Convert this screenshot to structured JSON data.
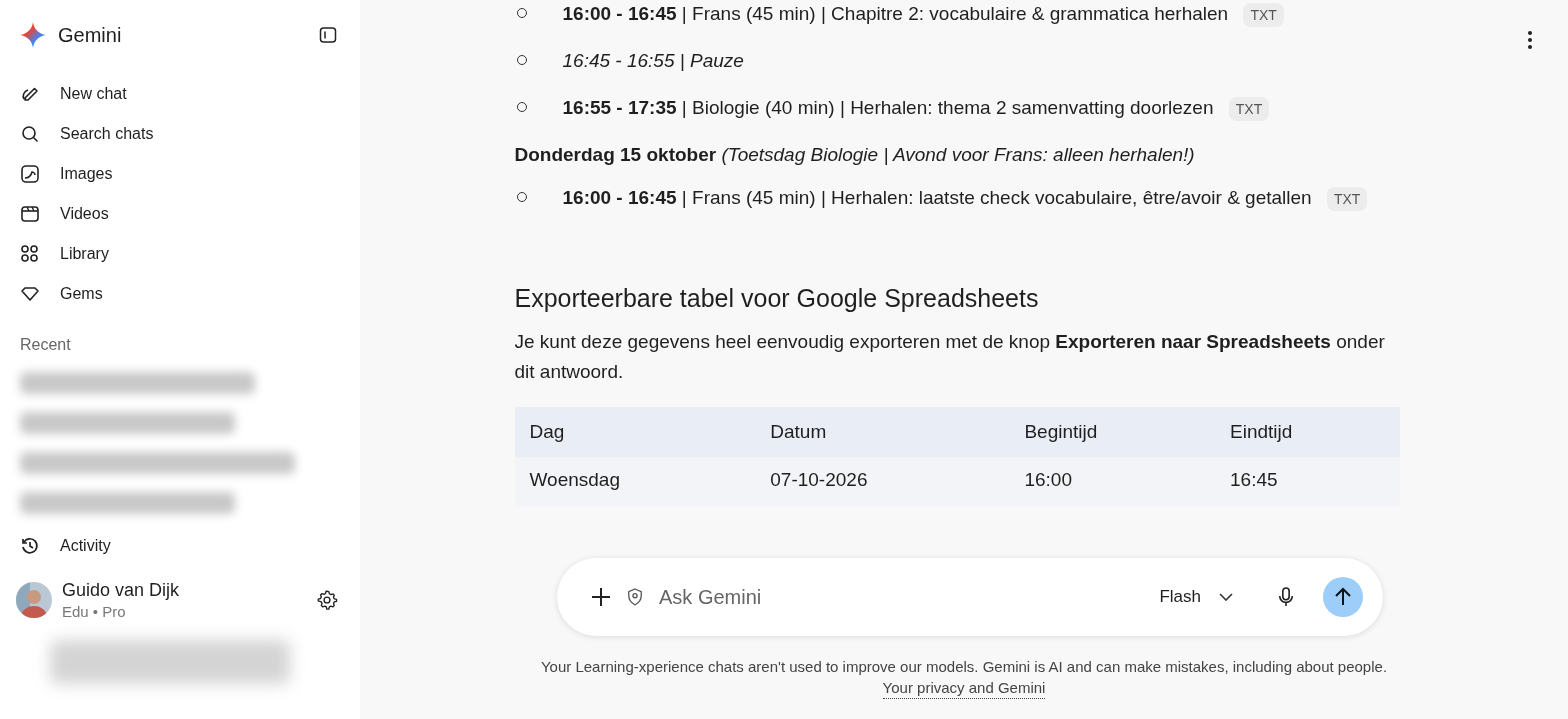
{
  "sidebar": {
    "brand": "Gemini",
    "nav": [
      {
        "kind": "new-chat",
        "label": "New chat"
      },
      {
        "kind": "search",
        "label": "Search chats"
      },
      {
        "kind": "images",
        "label": "Images"
      },
      {
        "kind": "videos",
        "label": "Videos"
      },
      {
        "kind": "library",
        "label": "Library"
      },
      {
        "kind": "gems",
        "label": "Gems"
      }
    ],
    "recent_heading": "Recent",
    "recent": [
      {
        "kind": "blurred"
      },
      {
        "kind": "blurred"
      },
      {
        "kind": "blurred"
      },
      {
        "kind": "blurred"
      }
    ],
    "activity": "Activity",
    "profile": {
      "name": "Guido van Dijk",
      "plan": "Edu • Pro"
    }
  },
  "chat": {
    "items": [
      {
        "kind": "bullet",
        "text": "**16:00 - 16:45** | Frans (45 min) | Chapitre 2: vocabulaire & grammatica herhalen",
        "italic": false,
        "badge": "TXT"
      },
      {
        "kind": "bullet",
        "text": "16:45 - 16:55 | Pauze",
        "italic": true
      },
      {
        "kind": "bullet",
        "text": "**16:55 - 17:35** | Biologie (40 min) | Herhalen: thema 2 samenvatting doorlezen",
        "italic": false,
        "badge": "TXT"
      },
      {
        "kind": "day",
        "text": "**Donderdag 15 oktober** *(Toetsdag Biologie | Avond voor Frans: alleen herhalen!)*"
      },
      {
        "kind": "bullet",
        "text": "**16:00 - 16:45** | Frans (45 min) | Herhalen: laatste check vocabulaire, être/avoir & getallen",
        "italic": false,
        "badge": "TXT"
      },
      {
        "kind": "heading",
        "text": "Exporteerbare tabel voor Google Spreadsheets"
      },
      {
        "kind": "paragraph",
        "text": "Je kunt deze gegevens heel eenvoudig exporteren met de knop **Exporteren naar Spreadsheets** onder dit antwoord."
      }
    ],
    "table": {
      "columns": [
        "Dag",
        "Datum",
        "Begintijd",
        "Eindtijd"
      ],
      "rows": [
        [
          "Woensdag",
          "07-10-2026",
          "16:00",
          "16:45"
        ]
      ]
    }
  },
  "composer": {
    "placeholder": "Ask Gemini",
    "model": "Flash"
  },
  "disclaimer": "Your Learning-xperience chats aren't used to improve our models. Gemini is AI and can make mistakes, including about people.",
  "privacy_link": "Your privacy and Gemini"
}
